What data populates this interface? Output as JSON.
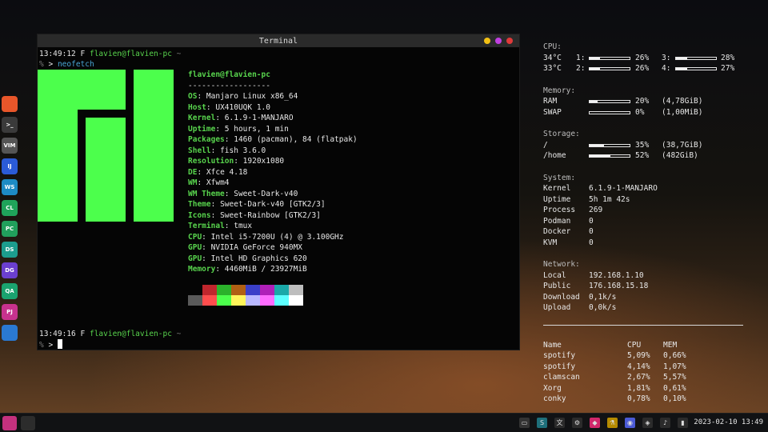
{
  "dock": {
    "items": [
      {
        "name": "firefox-icon",
        "label": "",
        "color": "#e8562a"
      },
      {
        "name": "terminal-icon",
        "label": ">_",
        "color": "#3a3a3a"
      },
      {
        "name": "vivaldi-icon",
        "label": "VIM",
        "color": "#555555"
      },
      {
        "name": "intellij-icon",
        "label": "IJ",
        "color": "#2b5bd7"
      },
      {
        "name": "webstorm-icon",
        "label": "WS",
        "color": "#1d8bc4"
      },
      {
        "name": "clion-icon",
        "label": "CL",
        "color": "#1fa35a"
      },
      {
        "name": "pycharm-icon",
        "label": "PC",
        "color": "#21a05c"
      },
      {
        "name": "dataspell-icon",
        "label": "DS",
        "color": "#1c9d8e"
      },
      {
        "name": "datagrip-icon",
        "label": "DG",
        "color": "#6b3fcf"
      },
      {
        "name": "aqua-icon",
        "label": "QA",
        "color": "#1aa36f"
      },
      {
        "name": "pyjet-icon",
        "label": "PJ",
        "color": "#c7328e"
      },
      {
        "name": "preview-icon",
        "label": "",
        "color": "#2a79d2"
      }
    ]
  },
  "terminal": {
    "title": "Terminal",
    "dots": [
      "#f2c014",
      "#c040e0",
      "#e03a3a"
    ],
    "prompt1": {
      "time": "13:49:12",
      "flag": "F",
      "user": "flavien@flavien-pc",
      "tilde": "~"
    },
    "cmd": {
      "symbol": "%",
      "arrow": ">",
      "text": "neofetch"
    },
    "prompt2": {
      "time": "13:49:16",
      "flag": "F",
      "user": "flavien@flavien-pc",
      "tilde": "~"
    },
    "cmd2": {
      "symbol": "%",
      "arrow": ">"
    },
    "neofetch": {
      "header": "flavien@flavien-pc",
      "separator": "------------------",
      "rows": [
        {
          "key": "OS",
          "value": "Manjaro Linux x86_64"
        },
        {
          "key": "Host",
          "value": "UX410UQK 1.0"
        },
        {
          "key": "Kernel",
          "value": "6.1.9-1-MANJARO"
        },
        {
          "key": "Uptime",
          "value": "5 hours, 1 min"
        },
        {
          "key": "Packages",
          "value": "1460 (pacman), 84 (flatpak)"
        },
        {
          "key": "Shell",
          "value": "fish 3.6.0"
        },
        {
          "key": "Resolution",
          "value": "1920x1080"
        },
        {
          "key": "DE",
          "value": "Xfce 4.18"
        },
        {
          "key": "WM",
          "value": "Xfwm4"
        },
        {
          "key": "WM Theme",
          "value": "Sweet-Dark-v40"
        },
        {
          "key": "Theme",
          "value": "Sweet-Dark-v40 [GTK2/3]"
        },
        {
          "key": "Icons",
          "value": "Sweet-Rainbow [GTK2/3]"
        },
        {
          "key": "Terminal",
          "value": "tmux"
        },
        {
          "key": "CPU",
          "value": "Intel i5-7200U (4) @ 3.100GHz"
        },
        {
          "key": "GPU",
          "value": "NVIDIA GeForce 940MX"
        },
        {
          "key": "GPU",
          "value": "Intel HD Graphics 620"
        },
        {
          "key": "Memory",
          "value": "4460MiB / 23927MiB"
        }
      ],
      "palette_top": [
        "#050505",
        "#c0262d",
        "#2bb22b",
        "#b06014",
        "#3a3fc8",
        "#b01fb8",
        "#1aa8a8",
        "#bdbdbd"
      ],
      "palette_bottom": [
        "#5a5a5a",
        "#ff4d4d",
        "#4cff4c",
        "#fff55a",
        "#b8b8ff",
        "#ff6bff",
        "#5cffff",
        "#ffffff"
      ]
    }
  },
  "conky": {
    "cpu": {
      "head": "CPU:",
      "rows": [
        {
          "temp": "34°C",
          "c1": "1:",
          "p1": "26%",
          "v1": 26,
          "c2": "3:",
          "p2": "28%",
          "v2": 28
        },
        {
          "temp": "33°C",
          "c1": "2:",
          "p1": "26%",
          "v1": 26,
          "c2": "4:",
          "p2": "27%",
          "v2": 27
        }
      ]
    },
    "memory": {
      "head": "Memory:",
      "rows": [
        {
          "label": "RAM",
          "pct": "20%",
          "v": 20,
          "extra": "(4,78GiB)"
        },
        {
          "label": "SWAP",
          "pct": "0%",
          "v": 0,
          "extra": "(1,00MiB)"
        }
      ]
    },
    "storage": {
      "head": "Storage:",
      "rows": [
        {
          "label": "/",
          "pct": "35%",
          "v": 35,
          "extra": "(38,7GiB)"
        },
        {
          "label": "/home",
          "pct": "52%",
          "v": 52,
          "extra": "(482GiB)"
        }
      ]
    },
    "system": {
      "head": "System:",
      "rows": [
        {
          "label": "Kernel",
          "value": "6.1.9-1-MANJARO"
        },
        {
          "label": "Uptime",
          "value": "5h 1m 42s"
        },
        {
          "label": "Process",
          "value": "269"
        },
        {
          "label": "Podman",
          "value": "0"
        },
        {
          "label": "Docker",
          "value": "0"
        },
        {
          "label": "KVM",
          "value": "0"
        }
      ]
    },
    "network": {
      "head": "Network:",
      "rows": [
        {
          "label": "Local",
          "value": "192.168.1.10"
        },
        {
          "label": "Public",
          "value": "176.168.15.18"
        },
        {
          "label": "Download",
          "value": "0,1k/s"
        },
        {
          "label": "Upload",
          "value": "0,0k/s"
        }
      ]
    },
    "processes": {
      "headers": [
        "Name",
        "CPU",
        "MEM"
      ],
      "rows": [
        {
          "name": "spotify",
          "cpu": "5,09%",
          "mem": "0,66%"
        },
        {
          "name": "spotify",
          "cpu": "4,14%",
          "mem": "1,07%"
        },
        {
          "name": "clamscan",
          "cpu": "2,67%",
          "mem": "5,57%"
        },
        {
          "name": "Xorg",
          "cpu": "1,81%",
          "mem": "0,61%"
        },
        {
          "name": "conky",
          "cpu": "0,78%",
          "mem": "0,10%"
        }
      ]
    }
  },
  "taskbar": {
    "tray": [
      {
        "name": "notes-icon",
        "label": "▭",
        "color": "#333333"
      },
      {
        "name": "app-tray-icon",
        "label": "S",
        "color": "#1e6f7a"
      },
      {
        "name": "translate-icon",
        "label": "文",
        "color": "#2b2b2b"
      },
      {
        "name": "settings-icon",
        "label": "⚙",
        "color": "#2b2b2b"
      },
      {
        "name": "jetbrains-toolbox-icon",
        "label": "◆",
        "color": "#d1286b"
      },
      {
        "name": "lab-flask-icon",
        "label": "⚗",
        "color": "#b58b00"
      },
      {
        "name": "discord-icon",
        "label": "◉",
        "color": "#4b5bd6"
      },
      {
        "name": "network-icon",
        "label": "◈",
        "color": "#2b2b2b"
      },
      {
        "name": "volume-icon",
        "label": "♪",
        "color": "#2b2b2b"
      },
      {
        "name": "battery-icon",
        "label": "▮",
        "color": "#2b2b2b"
      }
    ],
    "clock": "2023-02-10 13:49"
  }
}
